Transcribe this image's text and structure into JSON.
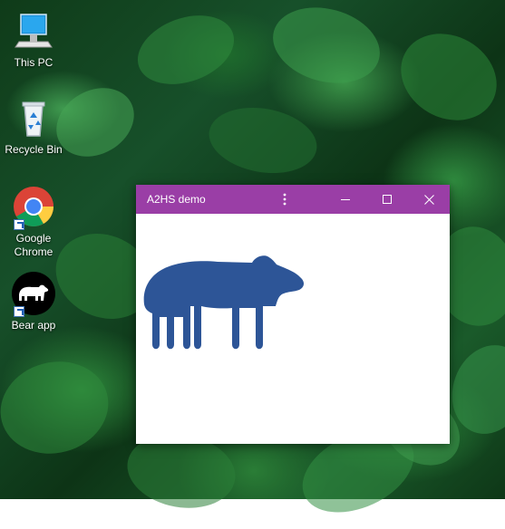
{
  "desktop": {
    "icons": [
      {
        "label": "This PC",
        "icon": "computer-icon",
        "shortcut": false
      },
      {
        "label": "Recycle Bin",
        "icon": "recycle-bin-icon",
        "shortcut": false
      },
      {
        "label": "Google\nChrome",
        "icon": "chrome-icon",
        "shortcut": true
      },
      {
        "label": "Bear app",
        "icon": "bear-app-icon",
        "shortcut": true
      }
    ]
  },
  "window": {
    "title": "A2HS demo",
    "titlebar_color": "#9a3ea6",
    "menu_icon": "kebab-menu-icon",
    "minimize_icon": "minimize-icon",
    "maximize_icon": "maximize-icon",
    "close_icon": "close-icon",
    "content_image": "bear-icon",
    "bear_color": "#2d5597"
  }
}
